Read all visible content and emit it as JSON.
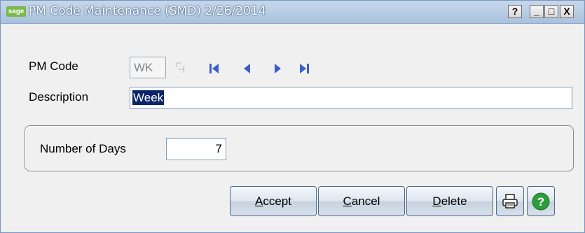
{
  "window": {
    "logo_text": "sage",
    "title": "PM Code Maintenance (SMD) 2/26/2014",
    "help_label": "?",
    "minimize_label": "_",
    "maximize_label": "□",
    "close_label": "X"
  },
  "form": {
    "pm_code_label": "PM Code",
    "pm_code_value": "WK",
    "description_label": "Description",
    "description_value": "Week",
    "days_label": "Number of Days",
    "days_value": "7"
  },
  "buttons": {
    "accept_u": "A",
    "accept_rest": "ccept",
    "cancel_u": "C",
    "cancel_rest": "ancel",
    "delete_u": "D",
    "delete_rest": "elete"
  },
  "icons": {
    "lookup": "lookup-icon",
    "first": "first-record-icon",
    "prev": "previous-record-icon",
    "next": "next-record-icon",
    "last": "last-record-icon",
    "print": "printer-icon",
    "help": "help-icon"
  },
  "colors": {
    "nav_blue": "#3a5fcd",
    "help_green": "#2e9e3a"
  }
}
